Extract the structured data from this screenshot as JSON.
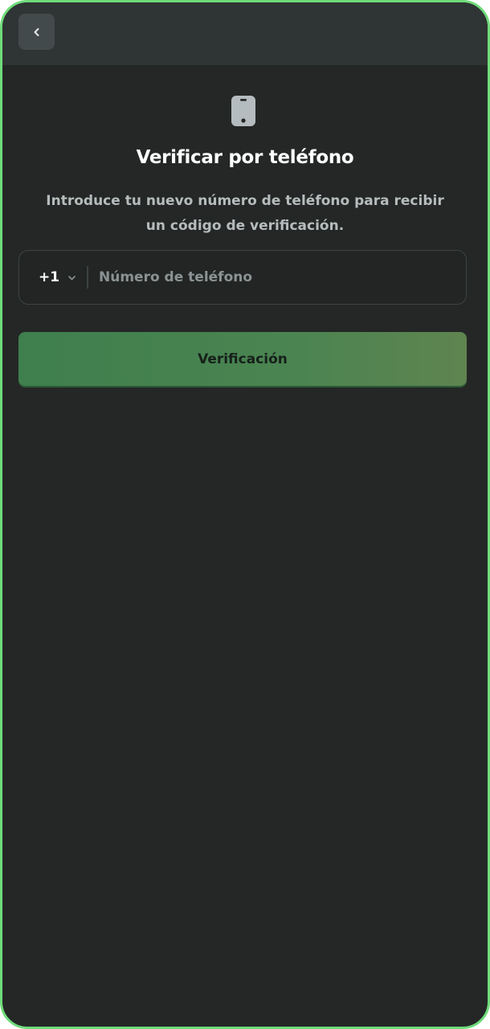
{
  "header": {
    "back_icon": "chevron-left-icon"
  },
  "main": {
    "icon": "phone-icon",
    "title": "Verificar por teléfono",
    "subtitle": "Introduce tu nuevo número de teléfono para recibir un código de verificación.",
    "country_code": "+1",
    "phone_value": "",
    "phone_placeholder": "Número de teléfono",
    "verify_label": "Verificación"
  },
  "colors": {
    "background": "#242726",
    "header": "#2f3434",
    "border_accent": "#6fdb7a",
    "button_green": "#4a8451"
  }
}
